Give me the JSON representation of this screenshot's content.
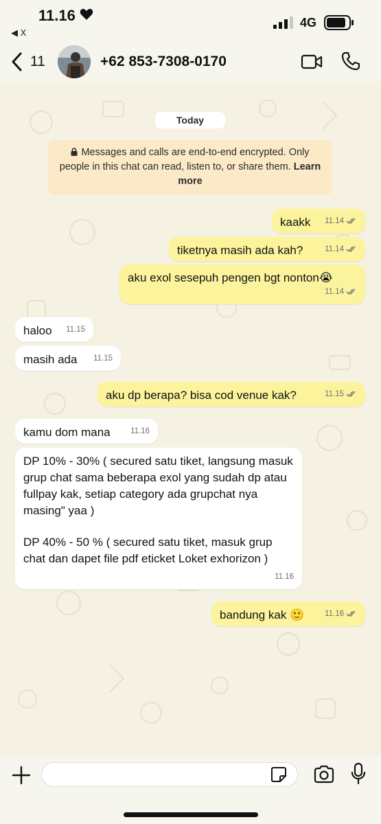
{
  "status": {
    "time": "11.16",
    "back_app": "◀ X",
    "network": "4G"
  },
  "header": {
    "back_count": "11",
    "contact": "+62 853-7308-0170",
    "icons": [
      "chevron-left-icon",
      "video-call-icon",
      "phone-icon"
    ]
  },
  "chat": {
    "date": "Today",
    "encryption": {
      "text": "Messages and calls are end-to-end encrypted. Only people in this chat can read, listen to, or share them.",
      "link": "Learn more"
    },
    "messages": [
      {
        "dir": "out",
        "text": "kaakk",
        "time": "11.14"
      },
      {
        "dir": "out",
        "text": "tiketnya masih ada kah?",
        "time": "11.14"
      },
      {
        "dir": "out",
        "text": "aku exol sesepuh pengen bgt nonton😭",
        "time": "11.14"
      },
      {
        "dir": "in",
        "text": "haloo",
        "time": "11.15"
      },
      {
        "dir": "in",
        "text": "masih ada",
        "time": "11.15"
      },
      {
        "dir": "out",
        "text": "aku dp berapa? bisa cod venue kak?",
        "time": "11.15"
      },
      {
        "dir": "in",
        "text": "kamu dom mana",
        "time": "11.16"
      },
      {
        "dir": "in",
        "text": "DP 10% - 30% ( secured satu tiket, langsung masuk grup chat sama beberapa exol yang sudah dp atau fullpay kak, setiap category ada grupchat nya masing\" yaa )",
        "text2": "DP 40% - 50 % ( secured satu tiket,  masuk grup chat dan dapet file pdf eticket Loket exhorizon )",
        "time": "11.16"
      },
      {
        "dir": "out",
        "text": "bandung kak 🙂",
        "time": "11.16"
      }
    ]
  },
  "composer": {
    "placeholder": "",
    "icons": [
      "plus-icon",
      "sticker-icon",
      "camera-icon",
      "microphone-icon"
    ]
  },
  "colors": {
    "outgoing_bubble": "#fbf49d",
    "incoming_bubble": "#ffffff",
    "background": "#f5f1e3",
    "encryption_notice": "#fbe9c7"
  }
}
